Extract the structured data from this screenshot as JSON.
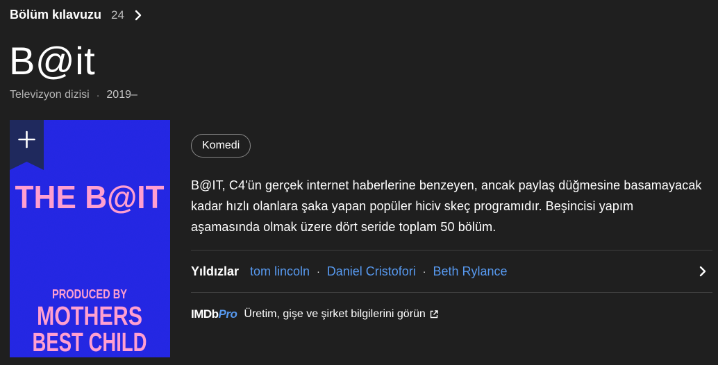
{
  "episode_guide": {
    "label": "Bölüm kılavuzu",
    "count": "24"
  },
  "title": "B@it",
  "meta": {
    "type": "Televizyon dizisi",
    "separator": "·",
    "years": "2019–"
  },
  "poster": {
    "title_text": "THE B@IT",
    "line1": "PRODUCED BY",
    "line2": "MOTHERS",
    "line3": "BEST CHILD",
    "background": "#2a2ef0",
    "text_color": "#ff9fd0"
  },
  "genre_chip": "Komedi",
  "description": "B@IT, C4'ün gerçek internet haberlerine benzeyen, ancak paylaş düğmesine basamayacak kadar hızlı olanlara şaka yapan popüler hiciv skeç programıdır. Beşincisi yapım aşamasında olmak üzere dört seride toplam 50 bölüm.",
  "stars": {
    "label": "Yıldızlar",
    "separator": "·",
    "people": [
      "tom lincoln",
      "Daniel Cristofori",
      "Beth Rylance"
    ]
  },
  "imdbpro": {
    "logo_main": "IMDb",
    "logo_pro": "Pro",
    "link_text": "Üretim, gişe ve şirket bilgilerini görün"
  },
  "colors": {
    "background": "#1f1f1f",
    "link": "#5799ef",
    "muted": "#b3b3b3"
  }
}
